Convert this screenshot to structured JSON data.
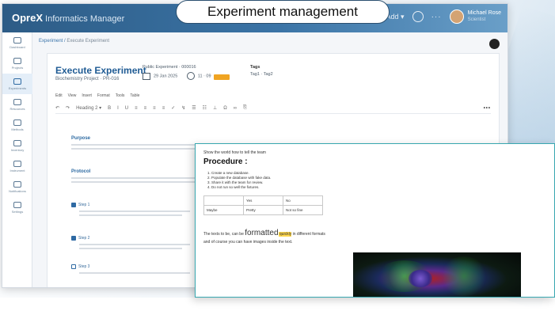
{
  "callout": {
    "label": "Experiment management"
  },
  "app": {
    "brand": "OpreX",
    "brand_sub": "Informatics Manager",
    "top_actions": {
      "add": "Add ▾",
      "more": "···"
    },
    "user": {
      "name": "Michael Rose",
      "role": "Scientist"
    }
  },
  "sidebar": {
    "items": [
      {
        "label": "Dashboard"
      },
      {
        "label": "Projects"
      },
      {
        "label": "Experiments"
      },
      {
        "label": "Resources"
      },
      {
        "label": "Methods"
      },
      {
        "label": "Inventory"
      },
      {
        "label": "Instrument"
      },
      {
        "label": "Notifications"
      },
      {
        "label": "Settings"
      }
    ]
  },
  "breadcrumb": {
    "link": "Experiment",
    "current": "Execute Experiment"
  },
  "experiment": {
    "title": "Execute Experiment",
    "project": "Biochemistry Project · PR-016",
    "id_label": "Public Experiment · 000016",
    "date": "29 Jan 2025",
    "time": "11 · 09",
    "tags_label": "Tags",
    "tags": "Tag1 · Tag2"
  },
  "editor": {
    "menu": [
      "Edit",
      "View",
      "Insert",
      "Format",
      "Tools",
      "Table"
    ],
    "toolbar": [
      "↶",
      "↷",
      "Heading 2 ▾",
      "B",
      "I",
      "U",
      "≡",
      "≡",
      "≡",
      "≡",
      "✓",
      "↯",
      "☰",
      "☷",
      "⊥",
      "Ω",
      "∞",
      "⎘"
    ],
    "toolbar_more": "•••"
  },
  "body_sections": {
    "purpose_title": "Purpose",
    "protocol_title": "Protocol",
    "steps": [
      "Step 1",
      "Step 2",
      "Step 3"
    ]
  },
  "document": {
    "note": "Show the world how to tell the team",
    "heading": "Procedure :",
    "steps": [
      "Create a new database.",
      "Populate the database with fake data.",
      "Share it with the team for review.",
      "Do not run so well the fixtures."
    ],
    "table": [
      [
        "",
        "Yes",
        "No"
      ],
      [
        "Maybe",
        "Pretty",
        "Not so fine"
      ]
    ],
    "para_prefix": "The texts to be, can be",
    "para_big": "formatted",
    "para_highlight": " quickly",
    "para_suffix": " in different formats",
    "para2": "and of course you can have images inside the text."
  }
}
